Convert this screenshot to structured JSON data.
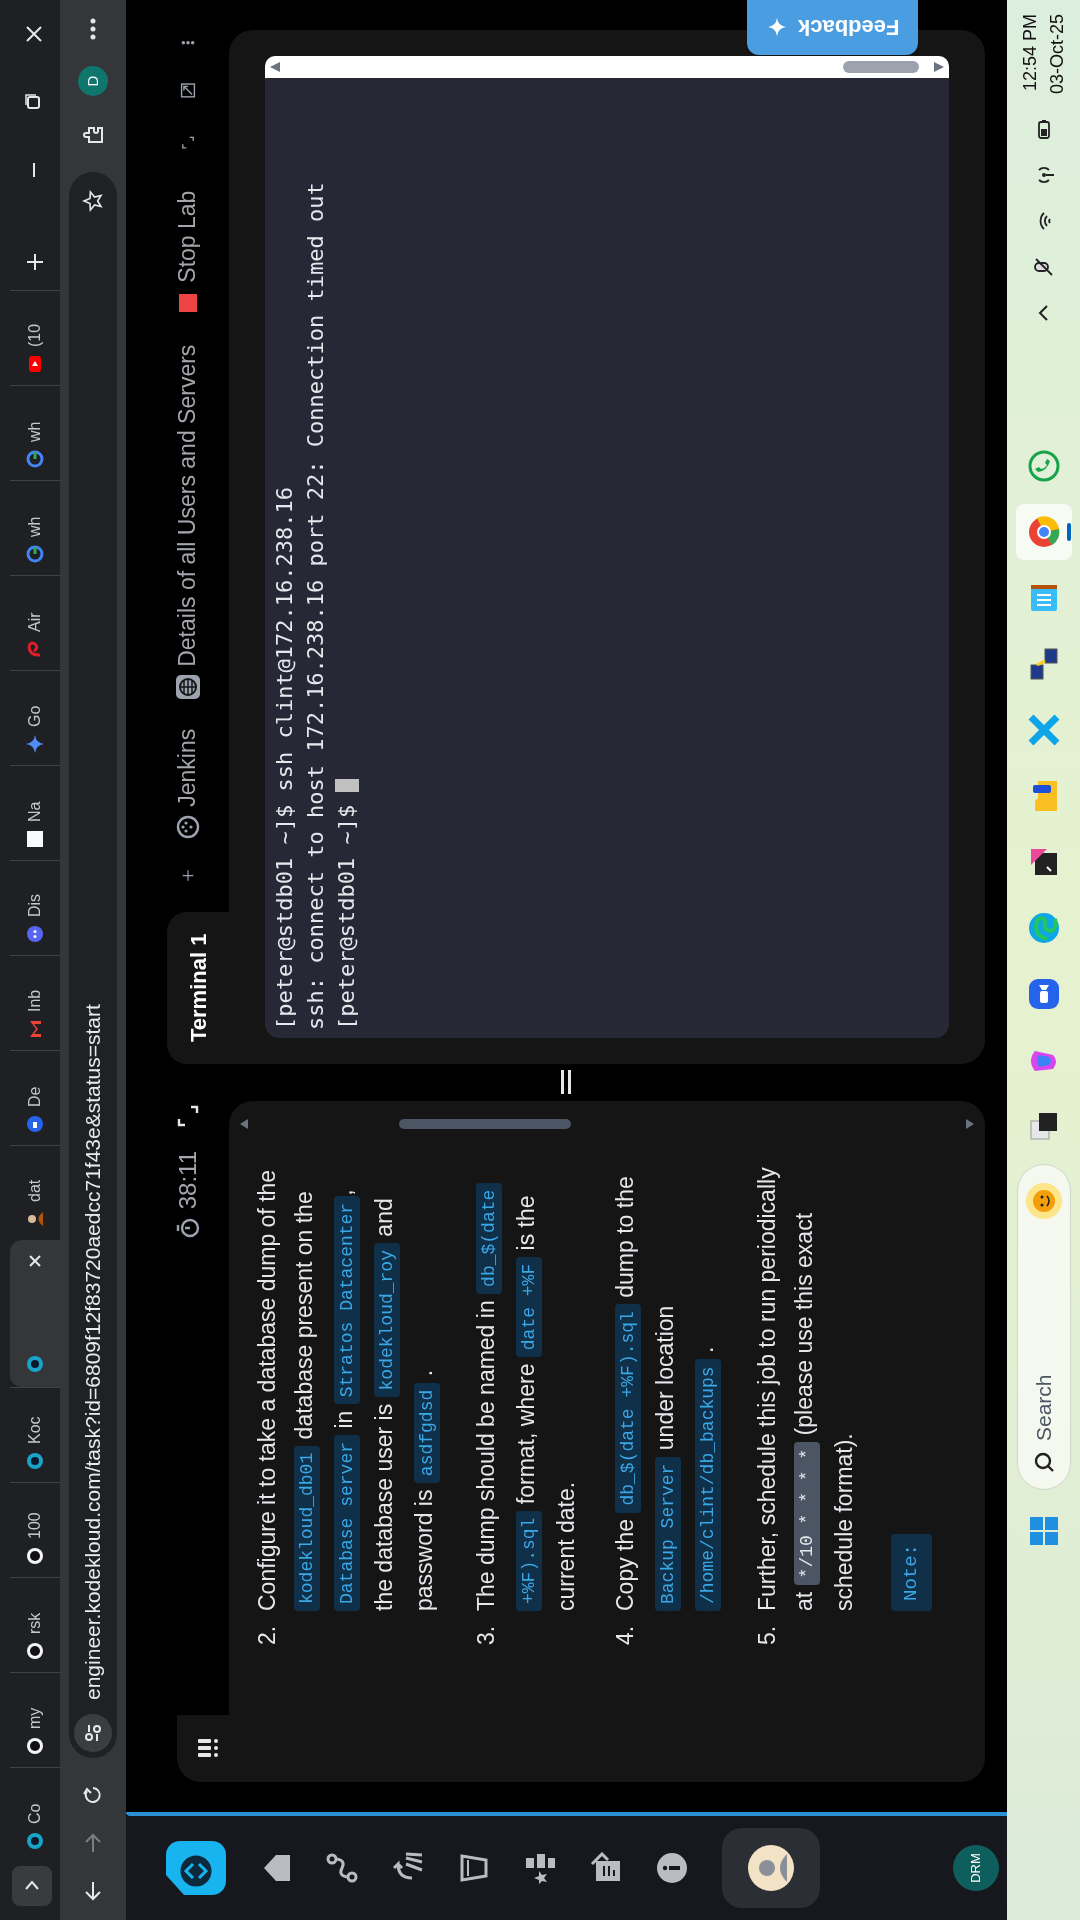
{
  "browser_tabs": [
    {
      "label": "Co",
      "selected": false
    },
    {
      "label": "my",
      "selected": false
    },
    {
      "label": "rsk",
      "selected": false
    },
    {
      "label": "100",
      "selected": false
    },
    {
      "label": "Koc",
      "selected": false
    },
    {
      "selected": true
    },
    {
      "label": "dat",
      "selected": false
    },
    {
      "label": "De",
      "selected": false
    },
    {
      "label": "Inb",
      "selected": false
    },
    {
      "label": "Dis",
      "selected": false
    },
    {
      "label": "Na",
      "selected": false
    },
    {
      "label": "Go",
      "selected": false
    },
    {
      "label": "Air",
      "selected": false
    },
    {
      "label": "wh",
      "selected": false
    },
    {
      "label": "wh",
      "selected": false
    },
    {
      "label": "(10",
      "selected": false
    }
  ],
  "address_bar": {
    "url": "engineer.kodekloud.com/task?id=6809f12f83720aedcc71f43e&status=start"
  },
  "profile": {
    "initial": "D"
  },
  "lab_header": {
    "timer": "38:11",
    "terminal_tabs": [
      {
        "label": "Terminal 1",
        "selected": true
      }
    ],
    "links": [
      {
        "label": "Jenkins"
      },
      {
        "label": "Details of all Users and Servers"
      },
      {
        "label": "Stop Lab"
      }
    ]
  },
  "instructions": [
    {
      "number": "2.",
      "segments": [
        {
          "kind": "text",
          "text": "Configure it to take a database dump of the "
        },
        {
          "kind": "code",
          "text": "kodekloud_db01"
        },
        {
          "kind": "text",
          "text": " database present on the "
        },
        {
          "kind": "code",
          "text": "Database server"
        },
        {
          "kind": "text",
          "text": " in "
        },
        {
          "kind": "code",
          "text": "Stratos Datacenter"
        },
        {
          "kind": "text",
          "text": ", the database user is "
        },
        {
          "kind": "code",
          "text": "kodekloud_roy"
        },
        {
          "kind": "text",
          "text": " and password is "
        },
        {
          "kind": "code",
          "text": "asdfgdsd"
        },
        {
          "kind": "text",
          "text": " ."
        }
      ]
    },
    {
      "number": "3.",
      "segments": [
        {
          "kind": "text",
          "text": "The dump should be named in "
        },
        {
          "kind": "code",
          "text": "db_$(date +%F).sql"
        },
        {
          "kind": "text",
          "text": " format, where "
        },
        {
          "kind": "code",
          "text": "date +%F"
        },
        {
          "kind": "text",
          "text": " is the current date."
        }
      ]
    },
    {
      "number": "4.",
      "segments": [
        {
          "kind": "text",
          "text": "Copy the "
        },
        {
          "kind": "code",
          "text": "db_$(date +%F).sql"
        },
        {
          "kind": "text",
          "text": " dump to the "
        },
        {
          "kind": "code",
          "text": "Backup Server"
        },
        {
          "kind": "text",
          "text": " under location "
        },
        {
          "kind": "code",
          "text": "/home/clint/db_backups"
        },
        {
          "kind": "text",
          "text": " ."
        }
      ]
    },
    {
      "number": "5.",
      "segments": [
        {
          "kind": "text",
          "text": "Further, schedule this job to run periodically at "
        },
        {
          "kind": "highlight",
          "text": "*/10 * * * *"
        },
        {
          "kind": "text",
          "text": " (please use this exact schedule format)."
        }
      ]
    }
  ],
  "note_badge": "Note:",
  "terminal": {
    "lines": [
      "[peter@stdb01 ~]$ ssh clint@172.16.238.16",
      "ssh: connect to host 172.16.238.16 port 22: Connection timed out",
      "[peter@stdb01 ~]$ "
    ],
    "cursor_visible": true
  },
  "feedback_button": "Feedback",
  "sidebar": {
    "badge": "DRM"
  },
  "taskbar": {
    "search_placeholder": "Search",
    "apps": [
      {
        "active": false
      },
      {
        "active": false
      },
      {
        "active": false
      },
      {
        "active": false
      },
      {
        "active": false
      },
      {
        "active": false
      },
      {
        "active": false
      },
      {
        "active": false
      },
      {
        "active": false
      },
      {
        "active": true
      },
      {
        "active": false
      }
    ],
    "time": "12:54 PM",
    "date": "03-Oct-25"
  }
}
